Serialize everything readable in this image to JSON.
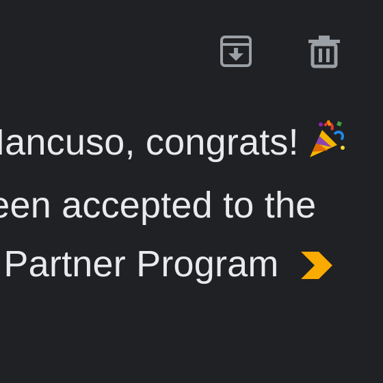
{
  "toolbar": {
    "archive_icon": "archive-icon",
    "delete_icon": "trash-icon",
    "icon_color": "#9aa0a6"
  },
  "email": {
    "subject_line1": "Mancuso, congrats!",
    "subject_line2": "been accepted to the",
    "subject_line3": "e Partner Program",
    "text_color": "#e8eaed",
    "party_emoji_icon": "party-popper-icon",
    "importance_marker_icon": "importance-marker-icon",
    "importance_marker_color": "#f9ab00"
  },
  "colors": {
    "background": "#202124"
  }
}
